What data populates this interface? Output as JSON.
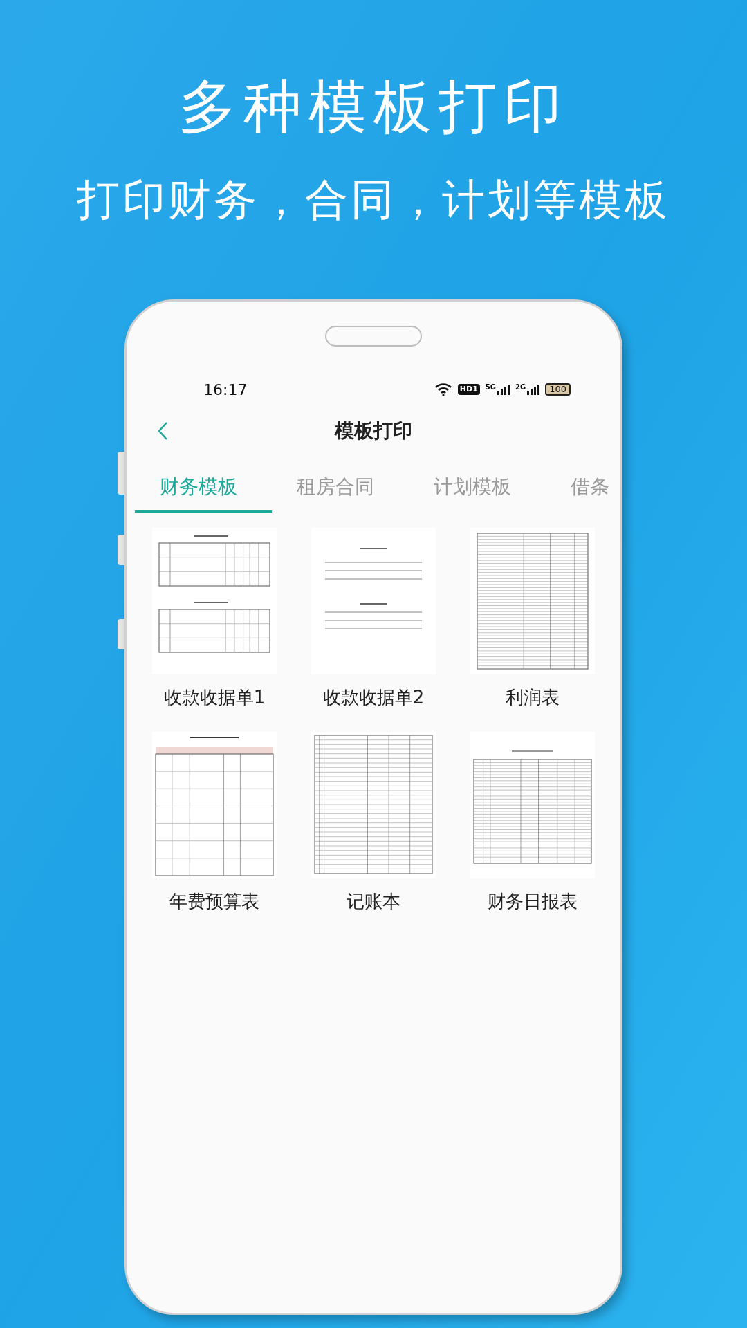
{
  "headline": "多种模板打印",
  "subheadline": "打印财务，合同，计划等模板",
  "status_bar": {
    "time": "16:17",
    "hd": "HD1",
    "network_a": "5G",
    "network_b": "2G",
    "battery": "100"
  },
  "header": {
    "title": "模板打印"
  },
  "tabs": [
    {
      "label": "财务模板",
      "selected": true
    },
    {
      "label": "租房合同",
      "selected": false
    },
    {
      "label": "计划模板",
      "selected": false
    },
    {
      "label": "借条",
      "selected": false
    }
  ],
  "templates": [
    {
      "label": "收款收据单1",
      "kind": "receipt-double"
    },
    {
      "label": "收款收据单2",
      "kind": "receipt-simple"
    },
    {
      "label": "利润表",
      "kind": "dense-table"
    },
    {
      "label": "年费预算表",
      "kind": "budget-table"
    },
    {
      "label": "记账本",
      "kind": "ledger"
    },
    {
      "label": "财务日报表",
      "kind": "report-table"
    }
  ]
}
